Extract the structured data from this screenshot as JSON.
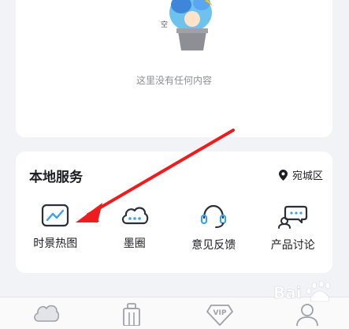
{
  "empty_state": {
    "text": "这里没有任何内容",
    "illustration": "empty-box-character"
  },
  "local_services": {
    "title": "本地服务",
    "location": "宛城区",
    "location_icon": "location-pin-icon",
    "items": [
      {
        "label": "时景热图",
        "icon": "heatmap-chart-icon"
      },
      {
        "label": "墨圈",
        "icon": "cloud-circle-icon"
      },
      {
        "label": "意见反馈",
        "icon": "headset-feedback-icon"
      },
      {
        "label": "产品讨论",
        "icon": "discussion-bubbles-icon"
      }
    ]
  },
  "tab_bar": {
    "items": [
      {
        "icon": "weather-icon"
      },
      {
        "icon": "tools-icon"
      },
      {
        "icon": "vip-icon",
        "text": "VIP"
      },
      {
        "icon": "profile-icon"
      }
    ]
  },
  "annotation": {
    "color": "#ee1c1c"
  },
  "watermark": {
    "text": "Bai",
    "brand": "baidu-paw-logo"
  },
  "colors": {
    "background": "#f2f3f7",
    "card": "#ffffff",
    "icon_dark": "#2b2f3a"
  }
}
